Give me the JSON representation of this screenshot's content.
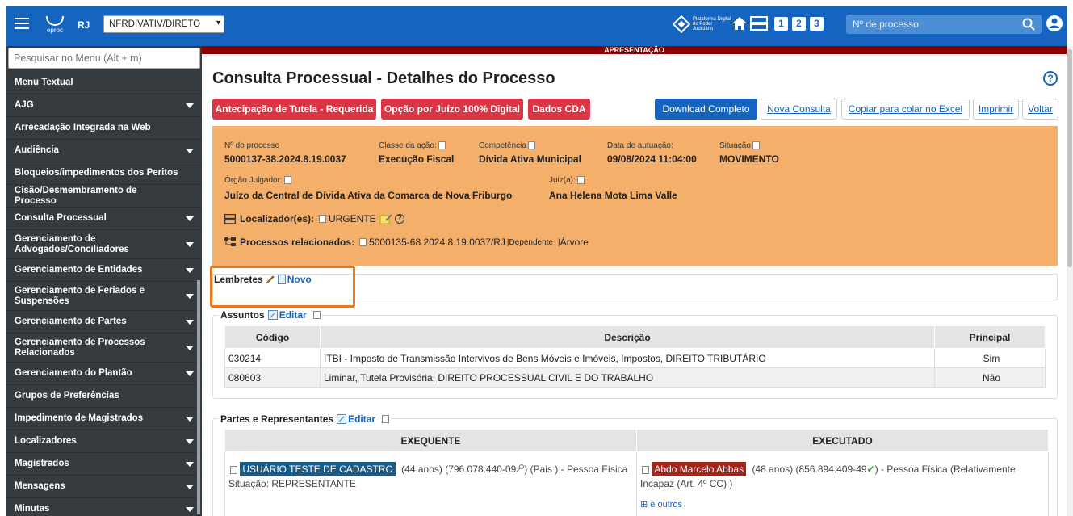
{
  "topbar": {
    "logo_text": "eproc",
    "uf": "RJ",
    "profile_select": "NFRDIVATIV/DIRETO",
    "platform_text": "Plataforma Digital do Poder Judiciário",
    "quick_nums": [
      "1",
      "2",
      "3"
    ],
    "search_placeholder": "Nº de processo"
  },
  "sidebar": {
    "search_placeholder": "Pesquisar no Menu (Alt + m)",
    "items": [
      {
        "label": "Menu Textual",
        "caret": false,
        "h": 28
      },
      {
        "label": "AJG",
        "caret": true,
        "h": 28
      },
      {
        "label": "Arrecadação Integrada na Web",
        "caret": false,
        "h": 28
      },
      {
        "label": "Audiência",
        "caret": true,
        "h": 28
      },
      {
        "label": "Bloqueios/impedimentos dos Peritos",
        "caret": false,
        "h": 28
      },
      {
        "label": "Cisão/Desmembramento de Processo",
        "caret": false,
        "h": 28
      },
      {
        "label": "Consulta Processual",
        "caret": true,
        "h": 28
      },
      {
        "label": "Gerenciamento de Advogados/Conciliadores",
        "caret": true,
        "h": 36
      },
      {
        "label": "Gerenciamento de Entidades",
        "caret": true,
        "h": 28
      },
      {
        "label": "Gerenciamento de Feriados e Suspensões",
        "caret": true,
        "h": 36
      },
      {
        "label": "Gerenciamento de Partes",
        "caret": true,
        "h": 28
      },
      {
        "label": "Gerenciamento de Processos Relacionados",
        "caret": true,
        "h": 36
      },
      {
        "label": "Gerenciamento do Plantão",
        "caret": true,
        "h": 28
      },
      {
        "label": "Grupos de Preferências",
        "caret": false,
        "h": 28
      },
      {
        "label": "Impedimento de Magistrados",
        "caret": true,
        "h": 28
      },
      {
        "label": "Localizadores",
        "caret": true,
        "h": 28
      },
      {
        "label": "Magistrados",
        "caret": true,
        "h": 28
      },
      {
        "label": "Mensagens",
        "caret": true,
        "h": 28
      },
      {
        "label": "Minutas",
        "caret": true,
        "h": 28
      }
    ]
  },
  "banner": "APRESENTAÇÃO",
  "page_title": "Consulta Processual - Detalhes do Processo",
  "buttons": {
    "tutela": "Antecipação de Tutela - Requerida",
    "juizo": "Opção por Juízo 100% Digital",
    "cda": "Dados CDA",
    "download": "Download Completo",
    "nova": "Nova Consulta",
    "copiar": "Copiar para colar no Excel",
    "imprimir": "Imprimir",
    "voltar": "Voltar"
  },
  "processo": {
    "numero_label": "Nº do processo",
    "numero": "5000137-38.2024.8.19.0037",
    "classe_label": "Classe da ação:",
    "classe": "Execução Fiscal",
    "competencia_label": "Competência",
    "competencia": "Dívida Ativa Municipal",
    "data_label": "Data de autuação:",
    "data": "09/08/2024 11:04:00",
    "situacao_label": "Situação",
    "situacao": "MOVIMENTO",
    "orgao_label": "Órgão Julgador:",
    "orgao": "Juízo da Central de Dívida Ativa da Comarca de Nova Friburgo",
    "juiz_label": "Juiz(a):",
    "juiz": "Ana Helena Mota Lima Valle",
    "localizador_label": "Localizador(es):",
    "localizador": "URGENTE",
    "relacionados_label": "Processos relacionados:",
    "relacionado": "5000135-68.2024.8.19.0037/RJ",
    "dependente": "Dependente",
    "arvore": "Árvore"
  },
  "lembretes": {
    "title": "Lembretes",
    "novo": "Novo"
  },
  "assuntos": {
    "title": "Assuntos",
    "editar": "Editar",
    "headers": [
      "Código",
      "Descrição",
      "Principal"
    ],
    "rows": [
      [
        "030214",
        "ITBI - Imposto de Transmissão Intervivos de Bens Móveis e Imóveis, Impostos, DIREITO TRIBUTÁRIO",
        "Sim"
      ],
      [
        "080603",
        "Liminar, Tutela Provisória, DIREITO PROCESSUAL CIVIL E DO TRABALHO",
        "Não"
      ]
    ]
  },
  "partes": {
    "title": "Partes e Representantes",
    "editar": "Editar",
    "exequente_header": "EXEQUENTE",
    "executado_header": "EXECUTADO",
    "exequente_name": "USUÁRIO TESTE DE CADASTRO",
    "exequente_info": "(44 anos)  (796.078.440-09",
    "exequente_info2": ")   (Pais )  - Pessoa Física",
    "exequente_situacao": "Situação: REPRESENTANTE",
    "executado_name": "Abdo Marcelo Abbas",
    "executado_info": "(48 anos)  (856.894.409-49",
    "executado_info2": ") - Pessoa Física  (Relativamente",
    "executado_info3": "Incapaz (Art. 4º CC) )",
    "outros": "e outros"
  }
}
